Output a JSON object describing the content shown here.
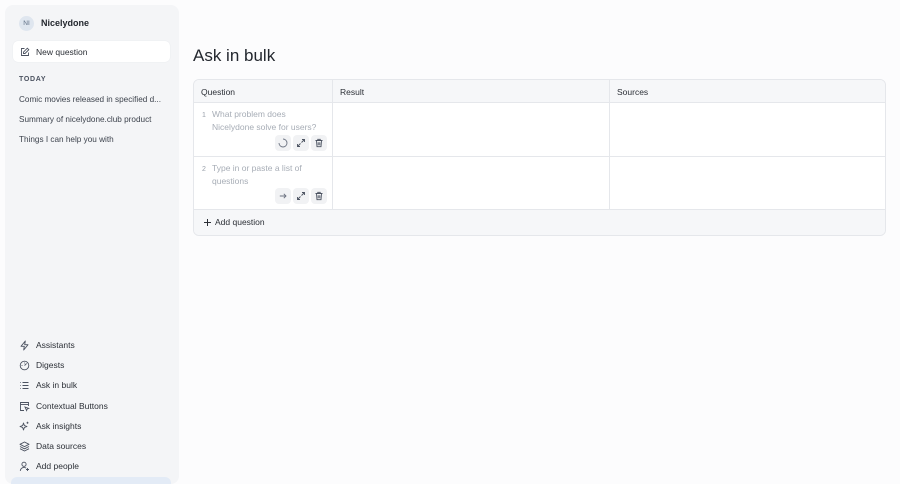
{
  "sidebar": {
    "workspace": {
      "initials": "NI",
      "name": "Nicelydone"
    },
    "new_question_label": "New question",
    "section_label": "TODAY",
    "history": [
      "Comic movies released in specified d...",
      "Summary of nicelydone.club product",
      "Things I can help you with"
    ],
    "nav": [
      {
        "label": "Assistants",
        "icon": "bolt-icon"
      },
      {
        "label": "Digests",
        "icon": "dashboard-gauge-icon"
      },
      {
        "label": "Ask in bulk",
        "icon": "list-icon"
      },
      {
        "label": "Contextual Buttons",
        "icon": "cursor-window-icon"
      },
      {
        "label": "Ask insights",
        "icon": "sparkles-icon"
      },
      {
        "label": "Data sources",
        "icon": "layers-icon"
      },
      {
        "label": "Add people",
        "icon": "user-plus-icon"
      }
    ]
  },
  "main": {
    "title": "Ask in bulk",
    "columns": [
      "Question",
      "Result",
      "Sources"
    ],
    "rows": [
      {
        "number": "1",
        "question": "What problem does Nicelydone solve for users?",
        "result": "",
        "sources": ""
      },
      {
        "number": "2",
        "question": "Type in or paste a list of questions",
        "result": "",
        "sources": ""
      }
    ],
    "add_question_label": "Add question"
  }
}
